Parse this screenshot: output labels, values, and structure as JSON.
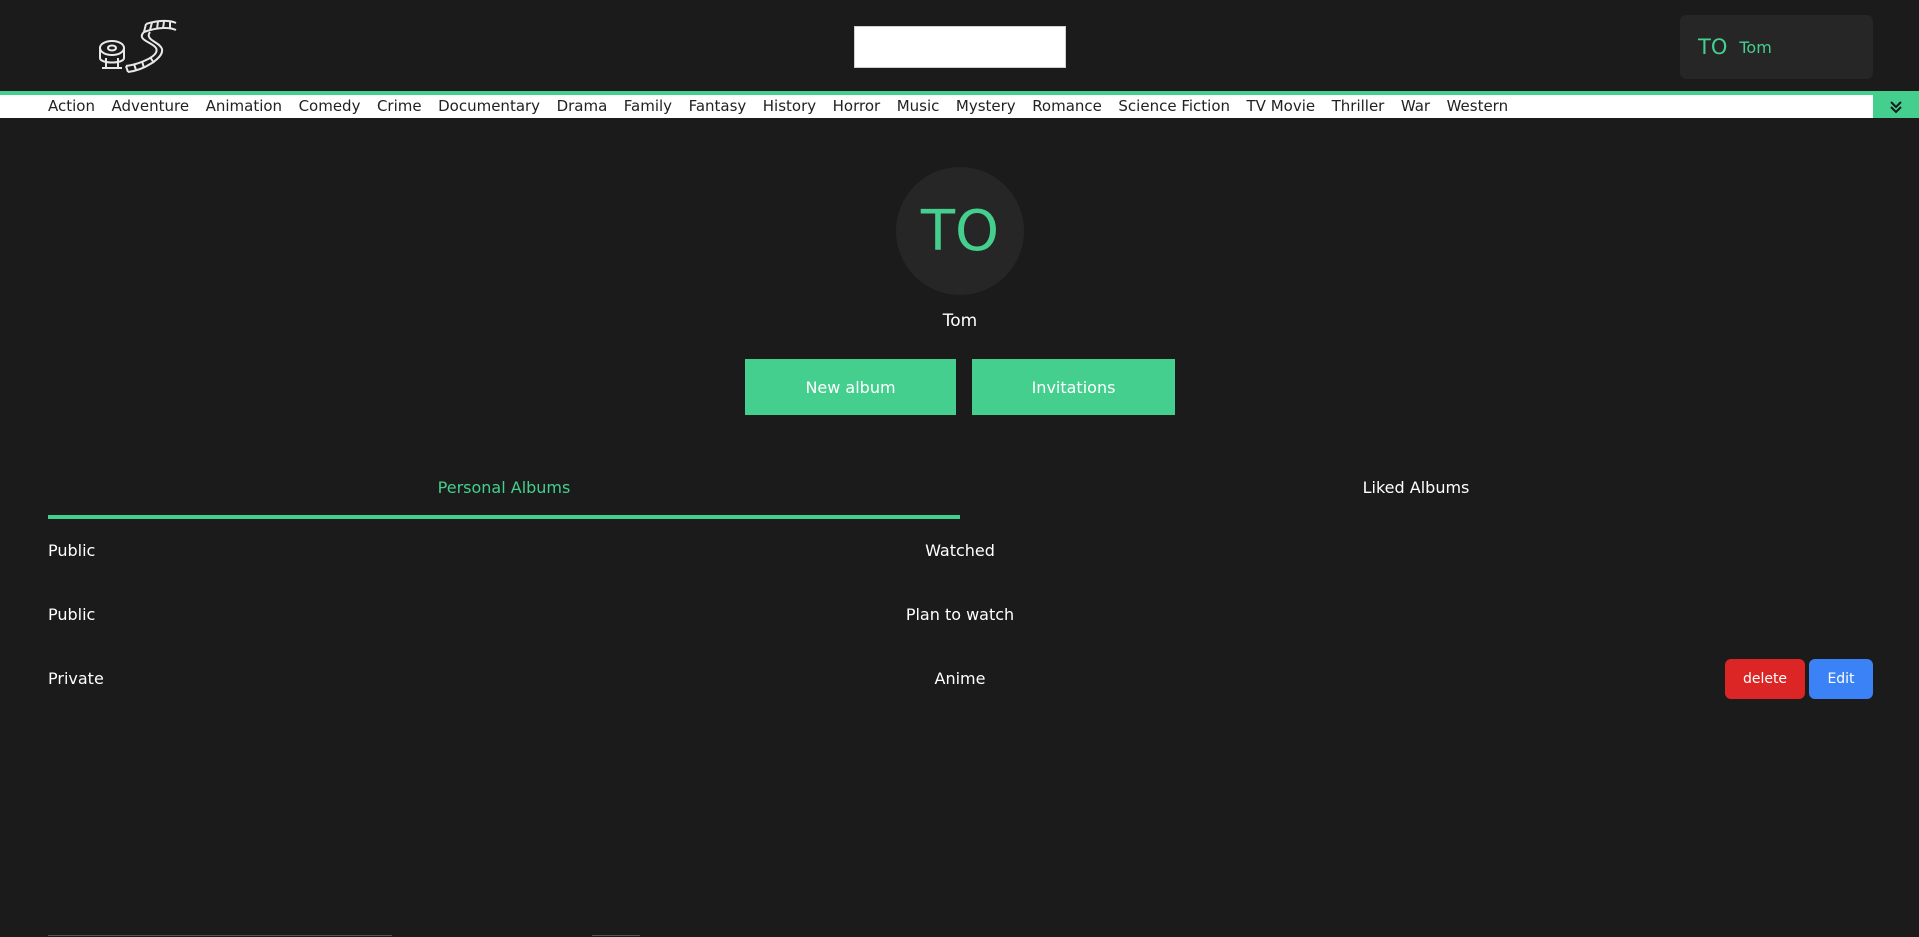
{
  "header": {
    "logo_icon": "film-reel-logo-icon",
    "search": {
      "value": "",
      "placeholder": ""
    },
    "user": {
      "initials": "TO",
      "name": "Tom"
    }
  },
  "genres": {
    "items": [
      "Action",
      "Adventure",
      "Animation",
      "Comedy",
      "Crime",
      "Documentary",
      "Drama",
      "Family",
      "Fantasy",
      "History",
      "Horror",
      "Music",
      "Mystery",
      "Romance",
      "Science Fiction",
      "TV Movie",
      "Thriller",
      "War",
      "Western"
    ],
    "toggle_icon": "double-chevron-down-icon"
  },
  "profile": {
    "initials": "TO",
    "name": "Tom",
    "new_album_label": "New album",
    "invitations_label": "Invitations"
  },
  "tabs": {
    "personal": "Personal Albums",
    "liked": "Liked Albums",
    "active": "personal"
  },
  "albums": [
    {
      "visibility": "Public",
      "title": "Watched",
      "actions": false
    },
    {
      "visibility": "Public",
      "title": "Plan to watch",
      "actions": false
    },
    {
      "visibility": "Private",
      "title": "Anime",
      "actions": true,
      "delete_label": "delete",
      "edit_label": "Edit"
    }
  ],
  "colors": {
    "background": "#1b1b1b",
    "accent": "#44cf8f",
    "delete": "#dc2626",
    "edit": "#3b82f6"
  }
}
